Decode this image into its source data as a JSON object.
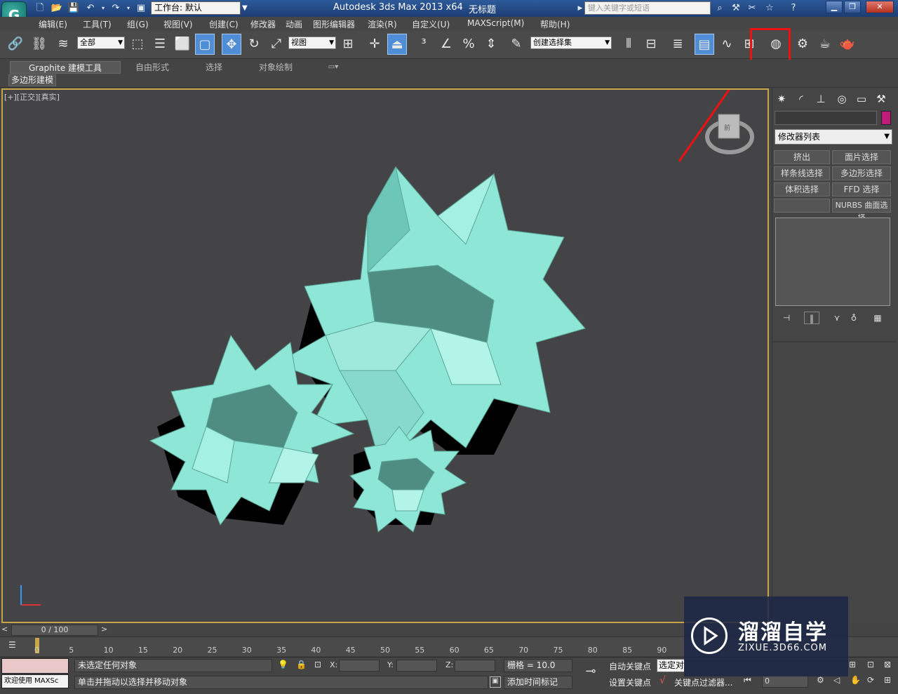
{
  "app": {
    "logo_text": "G",
    "title": "Autodesk 3ds Max  2013 x64",
    "document": "无标题",
    "workspace": "工作台: 默认",
    "search_placeholder": "键入关键字或短语"
  },
  "menu": [
    "编辑(E)",
    "工具(T)",
    "组(G)",
    "视图(V)",
    "创建(C)",
    "修改器",
    "动画",
    "图形编辑器",
    "渲染(R)",
    "自定义(U)",
    "MAXScript(M)",
    "帮助(H)"
  ],
  "toolbar": {
    "filter_select": "全部",
    "coord_select": "视图",
    "named_selection": "创建选择集"
  },
  "ribbon": {
    "tabs": [
      "Graphite 建模工具",
      "自由形式",
      "选择",
      "对象绘制"
    ],
    "sub_panel": "多边形建模"
  },
  "viewport": {
    "label": "[+][正交][真实]",
    "object_color": "#7fe0d0"
  },
  "command_panel": {
    "modifier_list": "修改器列表",
    "buttons": [
      "挤出",
      "面片选择",
      "样条线选择",
      "多边形选择",
      "体积选择",
      "FFD 选择",
      "",
      "NURBS 曲面选择"
    ]
  },
  "timeline": {
    "frame_display": "0 / 100",
    "ticks": [
      "0",
      "5",
      "10",
      "15",
      "20",
      "25",
      "30",
      "35",
      "40",
      "45",
      "50",
      "55",
      "60",
      "65",
      "70",
      "75",
      "80",
      "85",
      "90"
    ]
  },
  "status": {
    "maxscript_welcome": "欢迎使用 MAXSc",
    "selection": "未选定任何对象",
    "hint": "单击并拖动以选择并移动对象",
    "x_label": "X:",
    "y_label": "Y:",
    "z_label": "Z:",
    "grid": "栅格 = 10.0",
    "add_marker": "添加时间标记",
    "auto_key": "自动关键点",
    "set_key": "设置关键点",
    "selected_combo": "选定对",
    "key_filters": "关键点过滤器...",
    "frame": "0"
  },
  "watermark": {
    "title": "溜溜自学",
    "url": "ZIXUE.3D66.COM"
  }
}
